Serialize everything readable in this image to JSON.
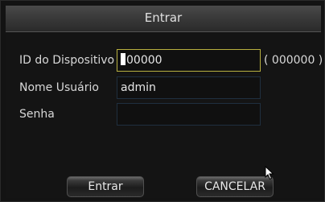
{
  "dialog": {
    "title": "Entrar"
  },
  "form": {
    "device_id": {
      "label": "ID do Dispositivo",
      "value": "00000",
      "hint": "( 000000 )"
    },
    "username": {
      "label": "Nome Usuário",
      "value": "admin"
    },
    "password": {
      "label": "Senha",
      "value": ""
    }
  },
  "buttons": {
    "login_label": "Entrar",
    "cancel_label": "CANCELAR"
  },
  "icons": {
    "pointer": "mouse-pointer-icon"
  },
  "colors": {
    "focus_border": "#b8b040",
    "field_border": "#1f2f3f"
  }
}
